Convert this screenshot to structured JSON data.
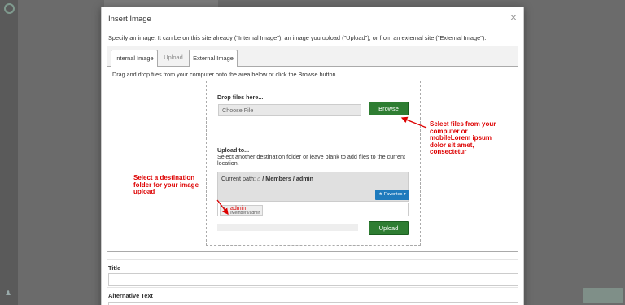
{
  "background": {
    "user_icon": "user-icon"
  },
  "dialog": {
    "title": "Insert Image",
    "close": "×",
    "description": "Specify an image. It can be on this site already (\"Internal Image\"), an image you upload (\"Upload\"), or from an external site (\"External Image\").",
    "tabs": [
      {
        "label": "Internal Image"
      },
      {
        "label": "Upload"
      },
      {
        "label": "External Image"
      }
    ],
    "upload": {
      "drag_help": "Drag and drop files from your computer onto the area below or click the Browse button.",
      "drop_label": "Drop files here...",
      "file_placeholder": "Choose File",
      "browse_label": "Browse",
      "upload_to_label": "Upload to...",
      "upload_to_help": "Select another destination folder or leave blank to add files to the current location.",
      "current_path_label": "Current path:",
      "current_path_value": "/ Members / admin",
      "favorites_label": "★ Favorites ▾",
      "token_name": "admin",
      "token_path": "/Members/admin",
      "upload_label": "Upload"
    },
    "annotations": {
      "select_files": "Select files from your computer or mobileLorem ipsum dolor sit amet, consectetur",
      "select_folder": "Select a destination folder for your image upload"
    },
    "fields": {
      "title_label": "Title",
      "alt_label": "Alternative Text"
    },
    "colors": {
      "accent_green": "#2e7d32",
      "favorites_blue": "#1f7bbd",
      "annotation_red": "#dd0000"
    }
  }
}
